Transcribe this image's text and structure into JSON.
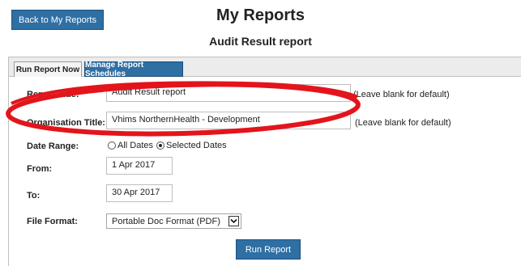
{
  "header": {
    "back_label": "Back to My Reports",
    "title": "My Reports",
    "subtitle": "Audit Result report"
  },
  "tabs": [
    {
      "label": "Run Report Now",
      "active": true
    },
    {
      "label": "Manage Report Schedules",
      "active": false
    }
  ],
  "form": {
    "report_title": {
      "label": "Report Title:",
      "value": "Audit Result report",
      "hint": "(Leave blank for default)"
    },
    "organisation_title": {
      "label": "Organisation Title:",
      "value": "Vhims NorthernHealth - Development",
      "hint": "(Leave blank for default)"
    },
    "date_range": {
      "label": "Date Range:",
      "options": [
        "All Dates",
        "Selected Dates"
      ],
      "selected": "Selected Dates"
    },
    "from": {
      "label": "From:",
      "value": "1 Apr 2017"
    },
    "to": {
      "label": "To:",
      "value": "30 Apr 2017"
    },
    "file_format": {
      "label": "File Format:",
      "value": "Portable Doc Format (PDF)"
    }
  },
  "run_label": "Run Report",
  "colors": {
    "accent": "#2e6fa4",
    "annotation": "#e3141b"
  }
}
